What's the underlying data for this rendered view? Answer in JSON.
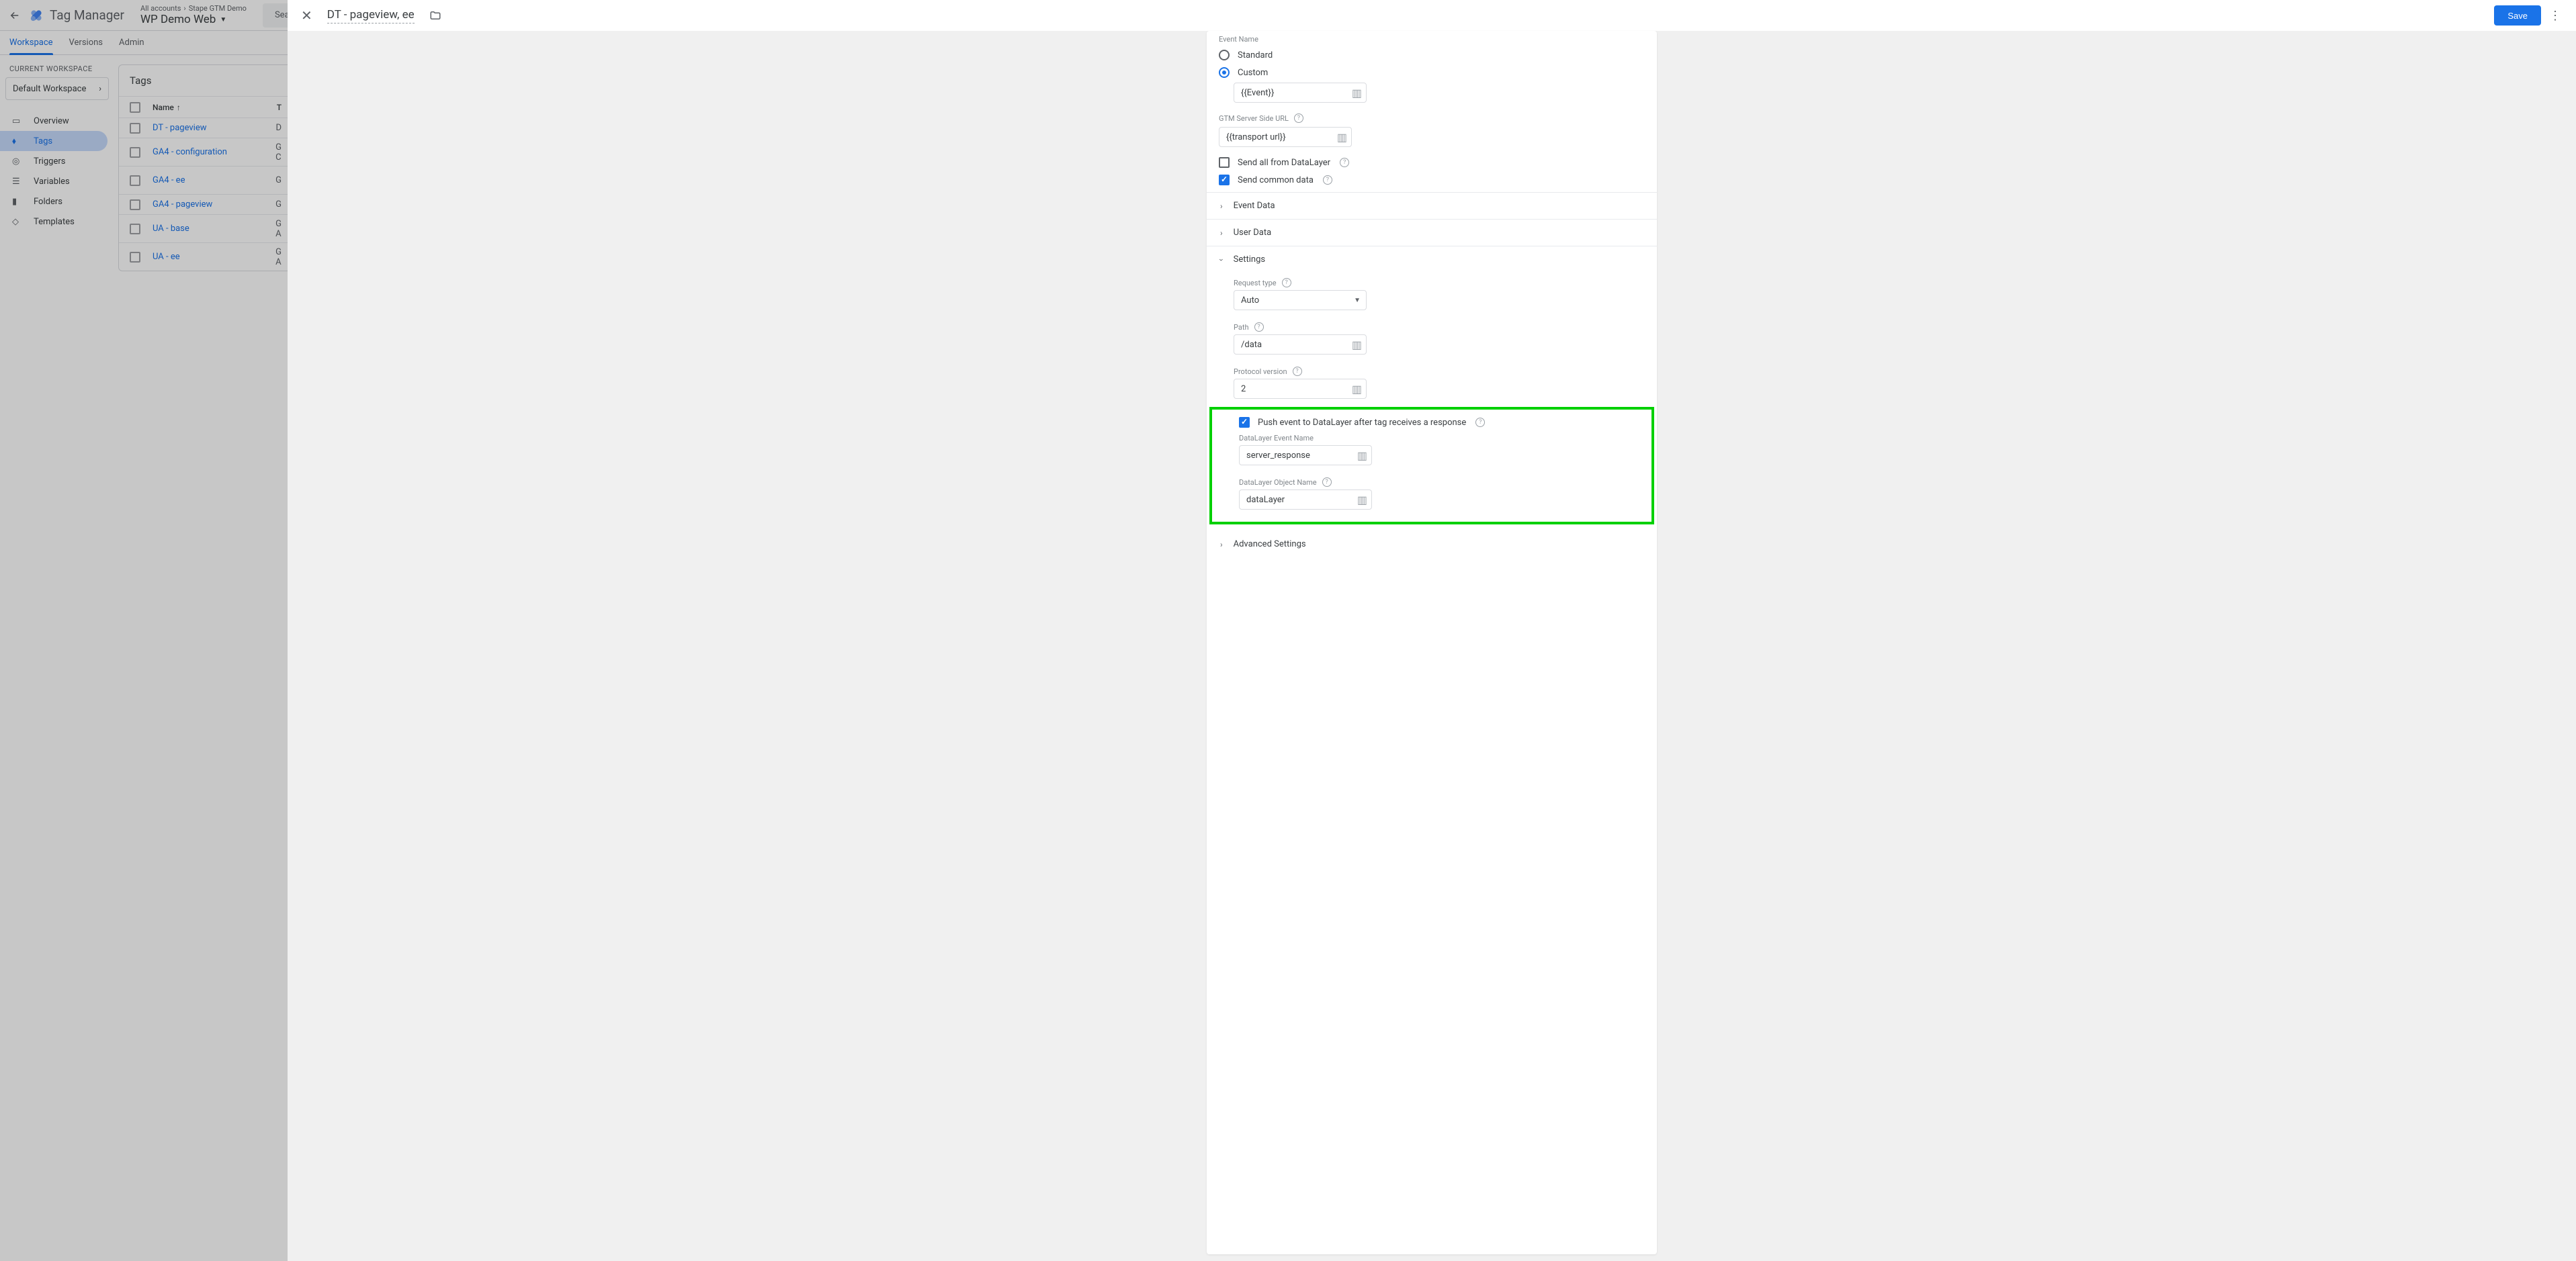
{
  "app": {
    "title": "Tag Manager",
    "account_crumb_1": "All accounts",
    "account_crumb_2": "Stape GTM Demo",
    "container": "WP Demo Web",
    "search_placeholder": "Search wo"
  },
  "tabs": {
    "workspace": "Workspace",
    "versions": "Versions",
    "admin": "Admin"
  },
  "sidebar": {
    "current_label": "CURRENT WORKSPACE",
    "workspace": "Default Workspace",
    "items": [
      "Overview",
      "Tags",
      "Triggers",
      "Variables",
      "Folders",
      "Templates"
    ]
  },
  "tags": {
    "title": "Tags",
    "header_name": "Name",
    "header_type": "T",
    "rows": [
      {
        "name": "DT - pageview",
        "type": "D"
      },
      {
        "name": "GA4 - configuration",
        "type": "G\nC"
      },
      {
        "name": "GA4 - ee",
        "type": "G"
      },
      {
        "name": "GA4 - pageview",
        "type": "G"
      },
      {
        "name": "UA - base",
        "type": "G\nA"
      },
      {
        "name": "UA - ee",
        "type": "G\nA"
      }
    ]
  },
  "panel": {
    "title": "DT - pageview, ee",
    "save": "Save",
    "event_name_label": "Event Name",
    "radio_standard": "Standard",
    "radio_custom": "Custom",
    "event_value": "{{Event}}",
    "gtm_url_label": "GTM Server Side URL",
    "gtm_url_value": "{{transport url}}",
    "send_all": "Send all from DataLayer",
    "send_common": "Send common data",
    "expand_event_data": "Event Data",
    "expand_user_data": "User Data",
    "expand_settings": "Settings",
    "req_type_label": "Request type",
    "req_type_value": "Auto",
    "path_label": "Path",
    "path_value": "/data",
    "proto_label": "Protocol version",
    "proto_value": "2",
    "push_label": "Push event to DataLayer after tag receives a response",
    "dl_event_label": "DataLayer Event Name",
    "dl_event_value": "server_response",
    "dl_obj_label": "DataLayer Object Name",
    "dl_obj_value": "dataLayer",
    "expand_advanced": "Advanced Settings"
  }
}
